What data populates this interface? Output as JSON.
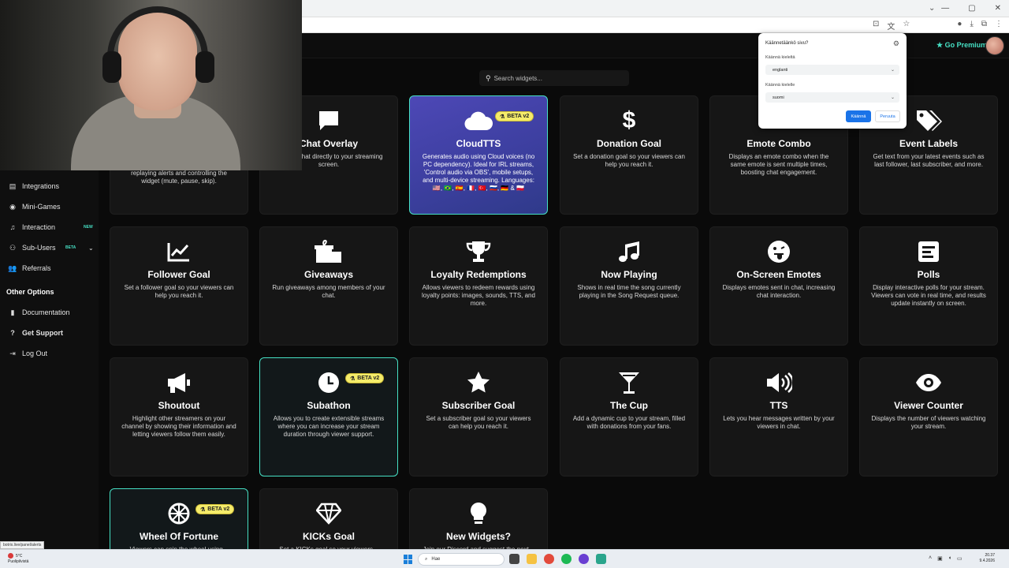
{
  "premium": {
    "label": "Go Premium"
  },
  "search": {
    "placeholder": "Search widgets..."
  },
  "sidebar": {
    "items": [
      {
        "label": "Integrations",
        "icon": "plug-icon"
      },
      {
        "label": "Mini-Games",
        "icon": "gamepad-icon"
      },
      {
        "label": "Interaction",
        "icon": "music-icon",
        "badge": "NEW"
      },
      {
        "label": "Sub-Users",
        "icon": "users-icon",
        "badge": "BETA"
      },
      {
        "label": "Referrals",
        "icon": "user-group-icon"
      }
    ],
    "other_heading": "Other Options",
    "other_items": [
      {
        "label": "Documentation",
        "icon": "book-icon"
      },
      {
        "label": "Get Support",
        "icon": "question-icon"
      },
      {
        "label": "Log Out",
        "icon": "logout-icon"
      }
    ]
  },
  "cards": [
    {
      "title": "",
      "desc": "replaying alerts and controlling the widget (mute, pause, skip)."
    },
    {
      "title": "Chat Overlay",
      "desc": "channel chat directly to your streaming screen."
    },
    {
      "title": "CloudTTS",
      "badge": "BETA v2",
      "desc": "Generates audio using Cloud voices (no PC dependency). Ideal for IRL streams, 'Control audio via OBS', mobile setups, and multi-device streaming. Languages: 🇺🇸, 🇧🇷, 🇪🇸, 🇫🇷, 🇹🇷, 🇷🇺, 🇩🇪 & 🇵🇱"
    },
    {
      "title": "Donation Goal",
      "desc": "Set a donation goal so your viewers can help you reach it."
    },
    {
      "title": "Emote Combo",
      "desc": "Displays an emote combo when the same emote is sent multiple times, boosting chat engagement."
    },
    {
      "title": "Event Labels",
      "desc": "Get text from your latest events such as last follower, last subscriber, and more."
    },
    {
      "title": "Follower Goal",
      "desc": "Set a follower goal so your viewers can help you reach it."
    },
    {
      "title": "Giveaways",
      "desc": "Run giveaways among members of your chat."
    },
    {
      "title": "Loyalty Redemptions",
      "desc": "Allows viewers to redeem rewards using loyalty points: images, sounds, TTS, and more."
    },
    {
      "title": "Now Playing",
      "desc": "Shows in real time the song currently playing in the Song Request queue."
    },
    {
      "title": "On-Screen Emotes",
      "desc": "Displays emotes sent in chat, increasing chat interaction."
    },
    {
      "title": "Polls",
      "desc": "Display interactive polls for your stream. Viewers can vote in real time, and results update instantly on screen."
    },
    {
      "title": "Shoutout",
      "desc": "Highlight other streamers on your channel by showing their information and letting viewers follow them easily."
    },
    {
      "title": "Subathon",
      "badge": "BETA v2",
      "desc": "Allows you to create extensible streams where you can increase your stream duration through viewer support."
    },
    {
      "title": "Subscriber Goal",
      "desc": "Set a subscriber goal so your viewers can help you reach it."
    },
    {
      "title": "The Cup",
      "desc": "Add a dynamic cup to your stream, filled with donations from your fans."
    },
    {
      "title": "TTS",
      "desc": "Lets you hear messages written by your viewers in chat."
    },
    {
      "title": "Viewer Counter",
      "desc": "Displays the number of viewers watching your stream."
    },
    {
      "title": "Wheel Of Fortune",
      "badge": "BETA v2",
      "desc": "Viewers can spin the wheel using..."
    },
    {
      "title": "KICKs Goal",
      "desc": "Set a KICKs goal so your viewers..."
    },
    {
      "title": "New Widgets?",
      "desc": "Join our Discord and suggest the next..."
    }
  ],
  "translate_popup": {
    "title": "Käännetäänkö sivu?",
    "from_label": "Käännä kieleltä",
    "from_value": "englanti",
    "to_label": "Käännä kielelle",
    "to_value": "suomi",
    "translate_button": "Käännä",
    "cancel_button": "Peruuta"
  },
  "status_url": "botrix.live/panel/alerts",
  "taskbar": {
    "temperature": "5°C",
    "weather": "Puolipilvistä",
    "search_placeholder": "Hae",
    "time": "20.37",
    "date": "9.4.2026"
  },
  "colors": {
    "accent": "#46e0c4",
    "beta": "#f5ec6a",
    "cloud_card": "#4d48b6",
    "primary_button": "#1a73e8"
  }
}
